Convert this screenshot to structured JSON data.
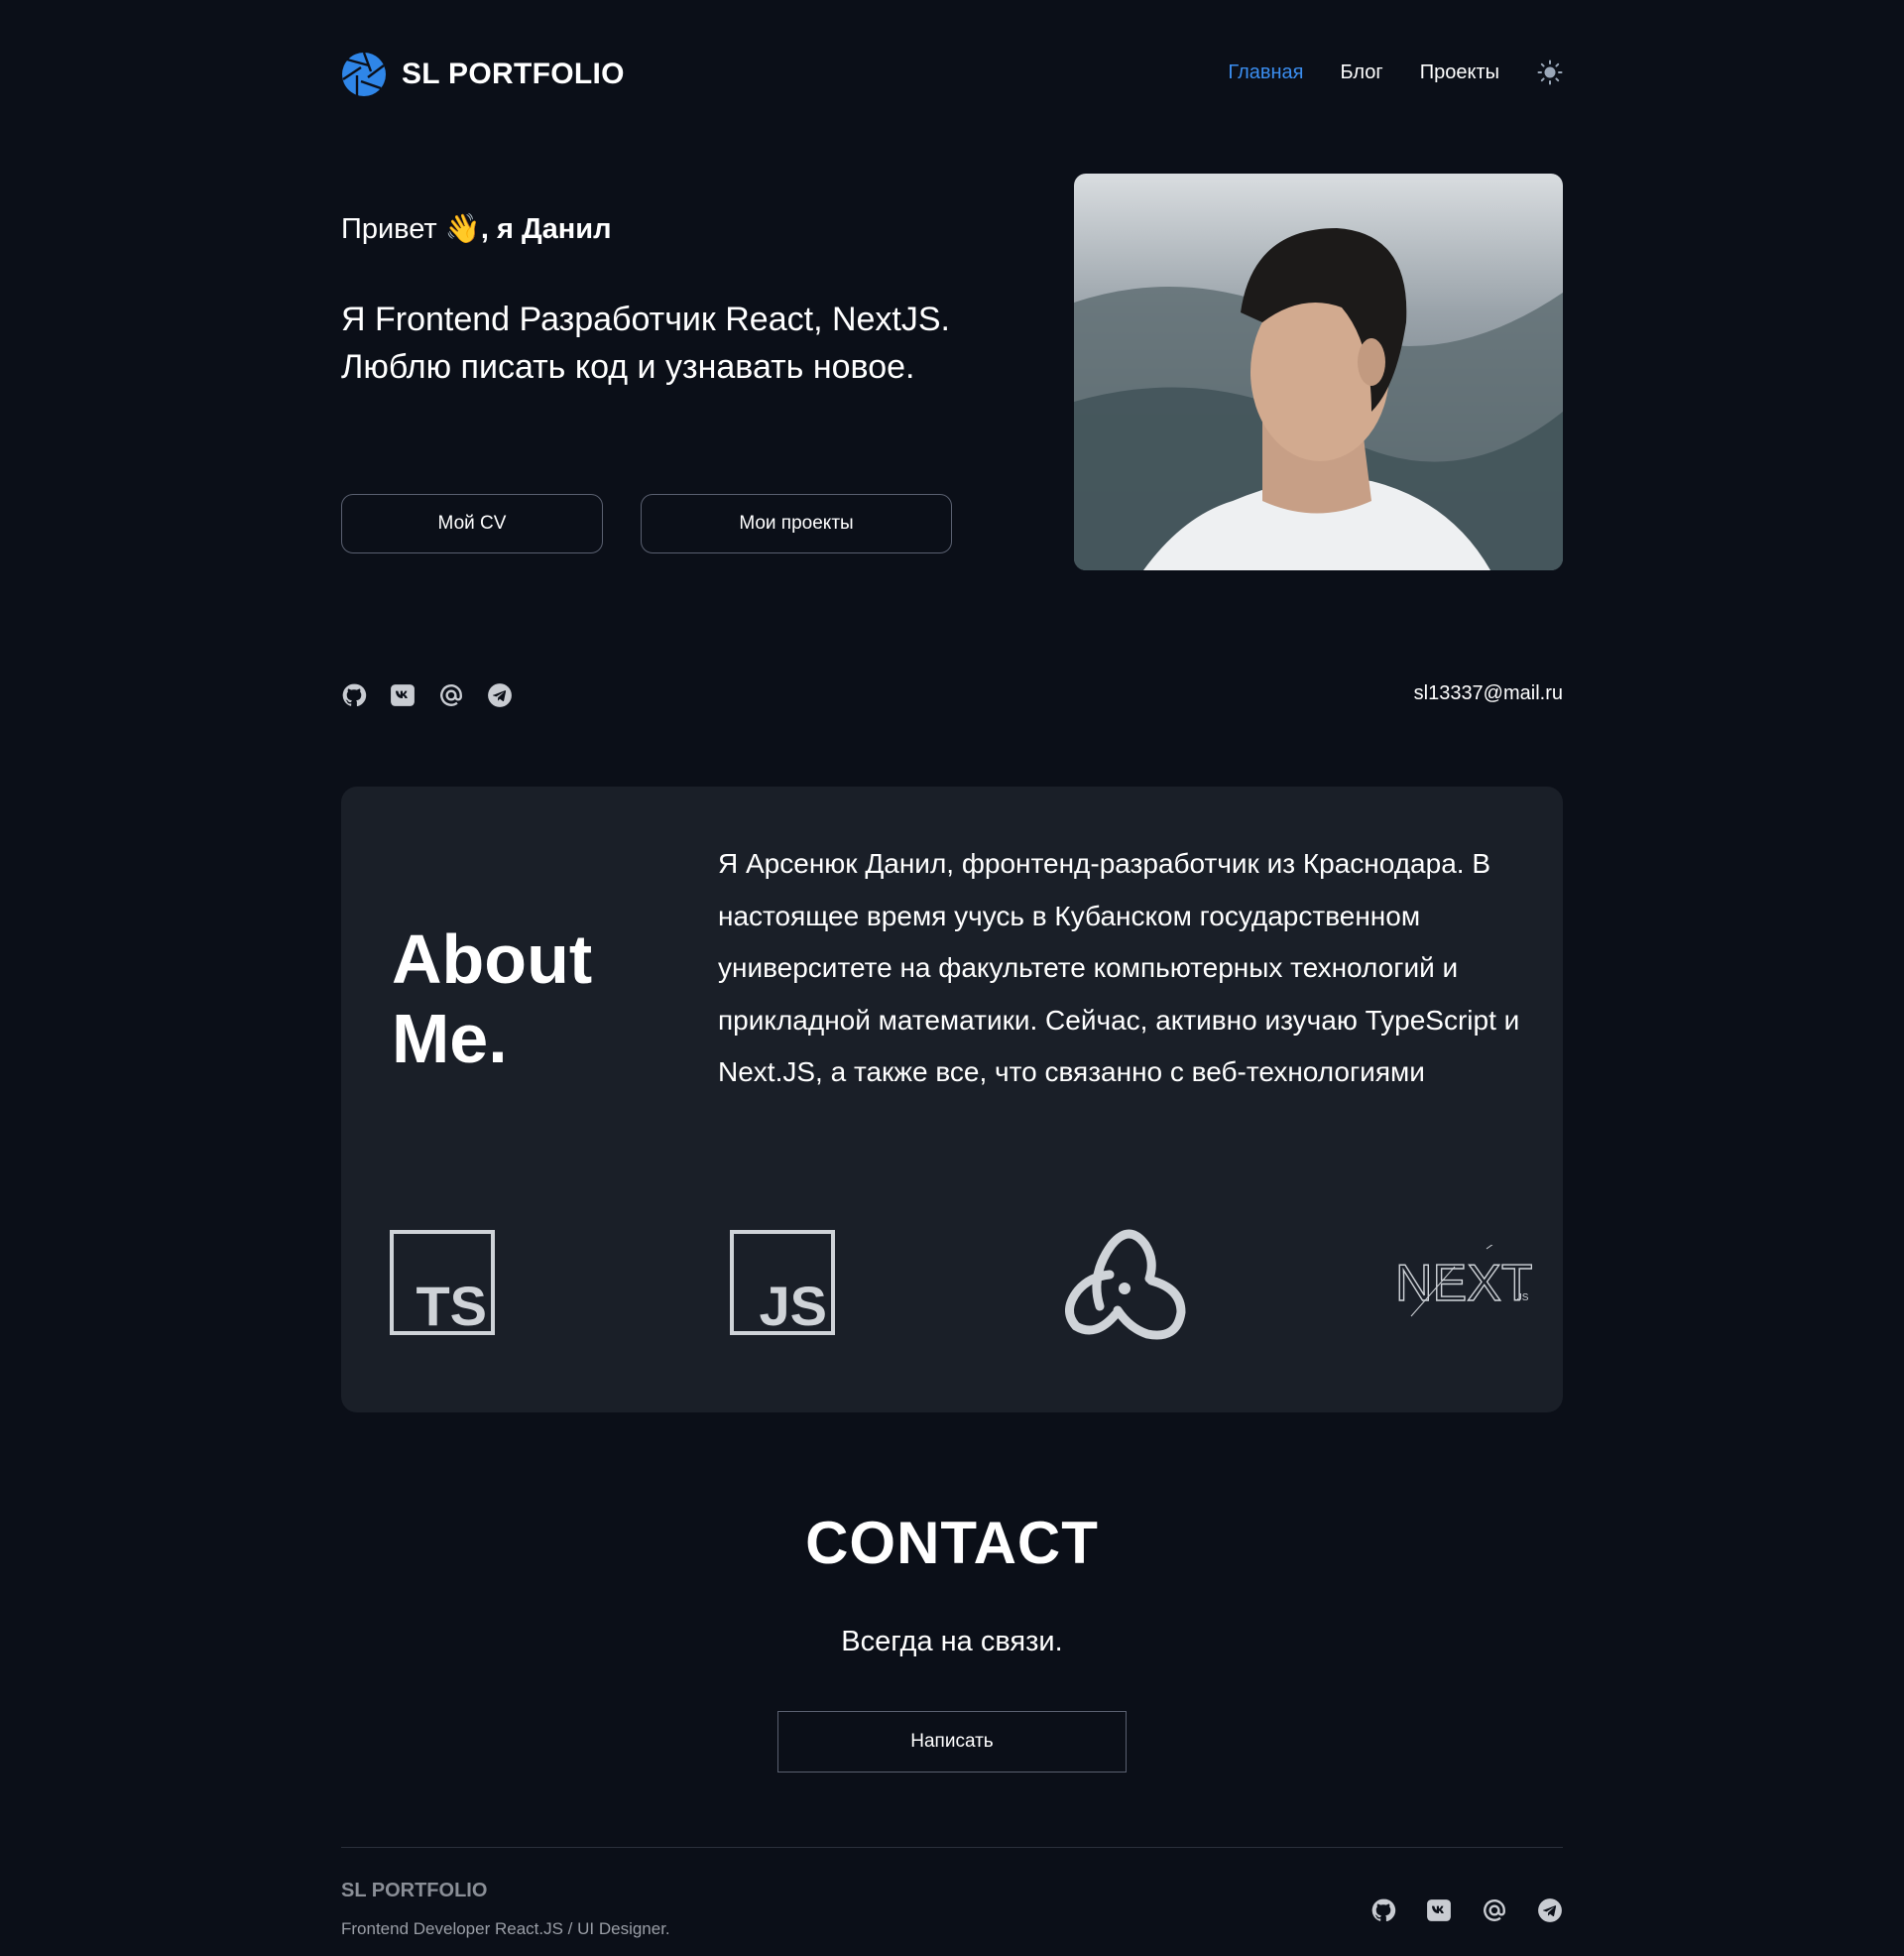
{
  "header": {
    "logo_text": "SL PORTFOLIO",
    "nav": [
      {
        "label": "Главная",
        "active": true
      },
      {
        "label": "Блог",
        "active": false
      },
      {
        "label": "Проекты",
        "active": false
      }
    ],
    "theme_icon": "sun-icon"
  },
  "hero": {
    "greeting_prefix": "Привет",
    "greeting_emoji": "👋",
    "greeting_name": ", я Данил",
    "tagline": "Я Frontend Разработчик React, NextJS. Люблю писать код и узнавать новое.",
    "cv_button": "Мой CV",
    "projects_button": "Мои проекты"
  },
  "socials": {
    "icons": [
      "github-icon",
      "vk-icon",
      "at-icon",
      "telegram-icon"
    ],
    "email": "sl13337@mail.ru"
  },
  "about": {
    "title_line1": "About",
    "title_line2": "Me.",
    "text": "Я Арсенюк Данил, фронтенд-разработчик из Краснодара. В настоящее время учусь в Кубанском государственном университете на факультете компьютерных технологий и прикладной математики. Сейчас, активно изучаю TypeScript и Next.JS, а также все, что связанно с веб-технологиями",
    "tech": [
      {
        "name": "typescript-logo",
        "label": "TS"
      },
      {
        "name": "javascript-logo",
        "label": "JS"
      },
      {
        "name": "redux-logo",
        "label": ""
      },
      {
        "name": "nextjs-logo",
        "label": "NEXT",
        "suffix": ".JS"
      }
    ]
  },
  "contact": {
    "title": "CONTACT",
    "subtitle": "Всегда на связи.",
    "button": "Написать"
  },
  "footer": {
    "title": "SL PORTFOLIO",
    "subtitle": "Frontend Developer React.JS / UI Designer."
  },
  "colors": {
    "background": "#0b0f18",
    "card": "#1a1f28",
    "accent": "#3b8ef0",
    "muted": "#8a8e96"
  }
}
